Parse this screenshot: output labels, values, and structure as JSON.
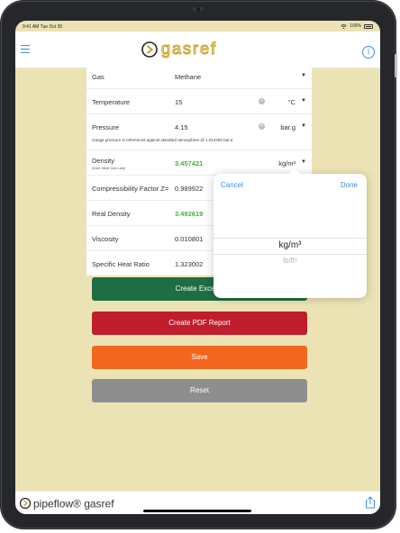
{
  "status_bar": {
    "time": "9:41 AM  Tue Oct 30",
    "battery": "100%"
  },
  "nav": {
    "title_logo": "gasref",
    "menu_icon": "hamburger-icon",
    "info_icon": "info-icon",
    "info_glyph": "i"
  },
  "form": {
    "gas": {
      "label": "Gas",
      "value": "Methane"
    },
    "temperature": {
      "label": "Temperature",
      "value": "15",
      "unit": "°C"
    },
    "pressure": {
      "label": "Pressure",
      "value": "4.15",
      "unit": "bar.g",
      "note": "Gauge pressure is referenced against standard atmosphere @ 1.013250 bar.a"
    },
    "density": {
      "label": "Density",
      "sublabel": "(from Ideal Gas Law)",
      "value": "3.457421",
      "unit": "kg/m³"
    },
    "compressibility": {
      "label": "Compressibility Factor Z=",
      "value": "0.989922"
    },
    "real_density": {
      "label": "Real Density",
      "value": "3.492619"
    },
    "viscosity": {
      "label": "Viscosity",
      "value": "0.010801"
    },
    "specific_heat_ratio": {
      "label": "Specific Heat Ratio",
      "value": "1.323002"
    }
  },
  "buttons": {
    "excel": "Create Excel R",
    "pdf": "Create PDF Report",
    "save": "Save",
    "reset": "Reset"
  },
  "picker": {
    "cancel": "Cancel",
    "done": "Done",
    "options": [
      "kg/m³",
      "lb/ft³"
    ],
    "selected": "kg/m³"
  },
  "tab_bar": {
    "logo": "pipeflow® gasref",
    "share_icon": "share-icon"
  },
  "colors": {
    "background": "#ece3b4",
    "accent": "#3b8fe9",
    "excel": "#1e6d44",
    "pdf": "#c01d2d",
    "save": "#f2661f",
    "reset": "#8e8e8e",
    "value_green": "#3ab83a"
  }
}
